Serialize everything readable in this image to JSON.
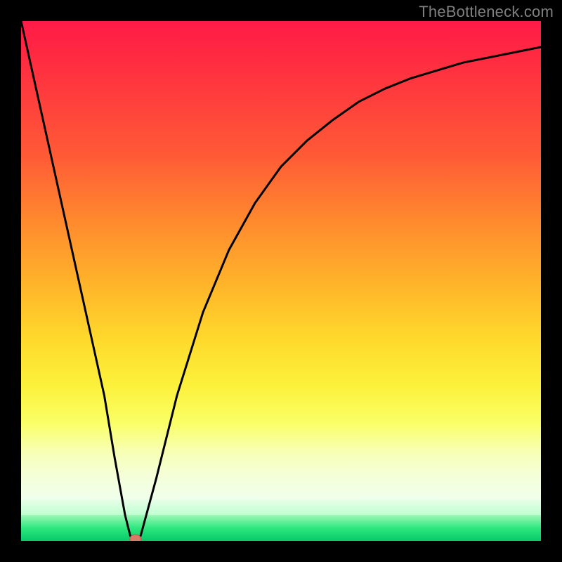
{
  "watermark": "TheBottleneck.com",
  "chart_data": {
    "type": "line",
    "title": "",
    "xlabel": "",
    "ylabel": "",
    "xlim": [
      0,
      100
    ],
    "ylim": [
      0,
      100
    ],
    "grid": false,
    "legend": false,
    "background": {
      "type": "vertical-gradient",
      "stops": [
        {
          "pos": 0.0,
          "color": "#ff1a46"
        },
        {
          "pos": 0.28,
          "color": "#ff5a36"
        },
        {
          "pos": 0.55,
          "color": "#ffb42a"
        },
        {
          "pos": 0.76,
          "color": "#fcf13a"
        },
        {
          "pos": 0.9,
          "color": "#f7ffb4"
        },
        {
          "pos": 0.95,
          "color": "#bfffd0"
        },
        {
          "pos": 1.0,
          "color": "#06c96a"
        }
      ]
    },
    "series": [
      {
        "name": "bottleneck-curve",
        "x": [
          0,
          4,
          8,
          12,
          16,
          18,
          20,
          21,
          22,
          23,
          26,
          30,
          35,
          40,
          45,
          50,
          55,
          60,
          65,
          70,
          75,
          80,
          85,
          90,
          95,
          100
        ],
        "y": [
          100,
          82,
          64,
          46,
          28,
          16,
          5,
          1,
          0,
          1,
          12,
          28,
          44,
          56,
          65,
          72,
          77,
          81,
          84.5,
          87,
          89,
          90.5,
          92,
          93,
          94,
          95
        ]
      }
    ],
    "marker": {
      "x": 22,
      "y": 0,
      "color": "#d87a6a"
    }
  }
}
